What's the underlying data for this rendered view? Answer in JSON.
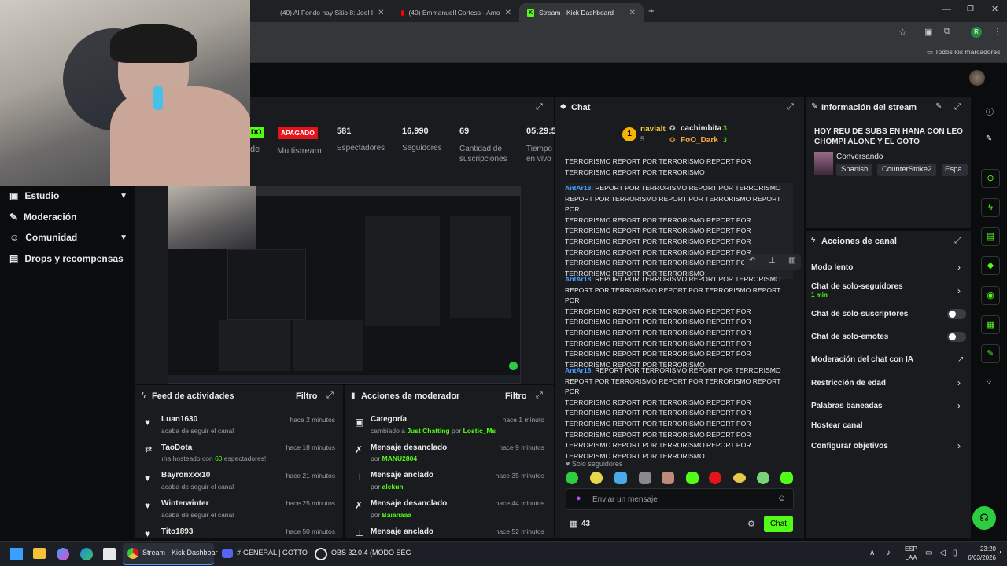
{
  "browser": {
    "tabs": [
      {
        "title": "(40) Al Fondo hay Sitio 8: Joel I"
      },
      {
        "title": "(40) Emmanuell Cortess - Amo"
      },
      {
        "title": "Stream - Kick Dashboard"
      }
    ],
    "bookmarks_label": "Todos los marcadores",
    "profile_initial": "R"
  },
  "sidebar": {
    "items": [
      {
        "label": "Estudio"
      },
      {
        "label": "Moderación"
      },
      {
        "label": "Comunidad"
      },
      {
        "label": "Drops y recompensas"
      }
    ]
  },
  "stream_stats": {
    "status_on": "DO",
    "multistream_badge": "APAGADO",
    "multistream_label": "Multistream",
    "viewers": "581",
    "viewers_label": "Espectadores",
    "followers": "16.990",
    "followers_label": "Seguidores",
    "subs": "69",
    "subs_label": "Cantidad de suscripciones",
    "uptime": "05:29:5",
    "uptime_label": "Tiempo en vivo",
    "partial_label": "de"
  },
  "feed": {
    "title": "Feed de actividades",
    "filter": "Filtro",
    "items": [
      {
        "name": "Luan1630",
        "sub": "acaba de seguir el canal",
        "time": "hace 2 minutos"
      },
      {
        "name": "TaoDota",
        "sub_pre": "¡ha hosteado con ",
        "sub_num": "60",
        "sub_post": " espectadores!",
        "time": "hace 18 minutos"
      },
      {
        "name": "Bayronxxx10",
        "sub": "acaba de seguir el canal",
        "time": "hace 21 minutos"
      },
      {
        "name": "Winterwinter",
        "sub": "acaba de seguir el canal",
        "time": "hace 25 minutos"
      },
      {
        "name": "Tito1893",
        "time": "hace 50 minutos"
      }
    ]
  },
  "modactions": {
    "title": "Acciones de moderador",
    "filter": "Filtro",
    "items": [
      {
        "name": "Categoría",
        "sub_pre": "cambiado a ",
        "sub_hl": "Just Chatting",
        "sub_mid": " por ",
        "sub_user": "Lostic_Ms",
        "time": "hace 1 minuto"
      },
      {
        "name": "Mensaje desanclado",
        "sub_pre": "por ",
        "sub_user": "MANU2804",
        "time": "hace 9 minutos"
      },
      {
        "name": "Mensaje anclado",
        "sub_pre": "por ",
        "sub_user": "alekun",
        "time": "hace 35 minutos"
      },
      {
        "name": "Mensaje desanclado",
        "sub_pre": "por ",
        "sub_user": "Baianaaa",
        "time": "hace 44 minutos"
      },
      {
        "name": "Mensaje anclado",
        "time": "hace 52 minutos"
      }
    ]
  },
  "chat": {
    "title": "Chat",
    "top": [
      {
        "name": "navialt",
        "count": "5"
      },
      {
        "name": "cachimbita",
        "count": "3"
      },
      {
        "name": "FoO_Dark",
        "count": "3"
      }
    ],
    "msg0": "TERRORISMO REPORT POR TERRORISMO REPORT POR\nTERRORISMO REPORT POR TERRORISMO",
    "messages": [
      {
        "user": "AntAr18",
        "text": ": REPORT POR TERRORISMO REPORT POR TERRORISMO\nREPORT POR TERRORISMO REPORT POR TERRORISMO REPORT POR\nTERRORISMO REPORT POR TERRORISMO REPORT POR\nTERRORISMO REPORT POR TERRORISMO REPORT POR\nTERRORISMO REPORT POR TERRORISMO REPORT POR\nTERRORISMO REPORT POR TERRORISMO REPORT POR\nTERRORISMO REPORT POR TERRORISMO REPORT POR\nTERRORISMO REPORT POR TERRORISMO"
      },
      {
        "user": "AntAr18",
        "text": ": REPORT POR TERRORISMO REPORT POR TERRORISMO\nREPORT POR TERRORISMO REPORT POR TERRORISMO REPORT POR\nTERRORISMO REPORT POR TERRORISMO REPORT POR\nTERRORISMO REPORT POR TERRORISMO REPORT POR\nTERRORISMO REPORT POR TERRORISMO REPORT POR\nTERRORISMO REPORT POR TERRORISMO REPORT POR\nTERRORISMO REPORT POR TERRORISMO REPORT POR\nTERRORISMO REPORT POR TERRORISMO"
      },
      {
        "user": "AntAr18",
        "text": ": REPORT POR TERRORISMO REPORT POR TERRORISMO\nREPORT POR TERRORISMO REPORT POR TERRORISMO REPORT POR\nTERRORISMO REPORT POR TERRORISMO REPORT POR\nTERRORISMO REPORT POR TERRORISMO REPORT POR\nTERRORISMO REPORT POR TERRORISMO REPORT POR\nTERRORISMO REPORT POR TERRORISMO REPORT POR\nTERRORISMO REPORT POR TERRORISMO REPORT POR\nTERRORISMO REPORT POR TERRORISMO"
      }
    ],
    "followers_only": "Solo seguidores",
    "input_placeholder": "Enviar un mensaje",
    "viewer_count": "43",
    "send_label": "Chat"
  },
  "stream_info": {
    "title": "Información del stream",
    "stream_title": "HOY REU DE SUBS EN HANA CON LEO CHOMPI ALONE Y EL GOTO",
    "category": "Conversando",
    "tags": [
      "Spanish",
      "CounterStrike2",
      "Espa"
    ]
  },
  "channel_actions": {
    "title": "Acciones de canal",
    "items": [
      {
        "label": "Modo lento"
      },
      {
        "label": "Chat de solo-seguidores",
        "sub": "1 min"
      },
      {
        "label": "Chat de solo-suscriptores"
      },
      {
        "label": "Chat de solo-emotes"
      },
      {
        "label": "Moderación del chat con IA"
      },
      {
        "label": "Restricción de edad"
      },
      {
        "label": "Palabras baneadas"
      },
      {
        "label": "Hostear canal"
      },
      {
        "label": "Configurar objetivos"
      }
    ]
  },
  "taskbar": {
    "items": [
      {
        "label": "Stream - Kick Dashboar"
      },
      {
        "label": "#-GENERAL | GOTTO"
      },
      {
        "label": "OBS 32.0.4 (MODO SEG"
      }
    ],
    "lang": "ESP",
    "lang2": "LAA",
    "time": "23:20",
    "date": "6/03/2026"
  },
  "colors": {
    "accent": "#53fc18",
    "username": "#4a9bff",
    "badge_red": "#e5141c"
  }
}
